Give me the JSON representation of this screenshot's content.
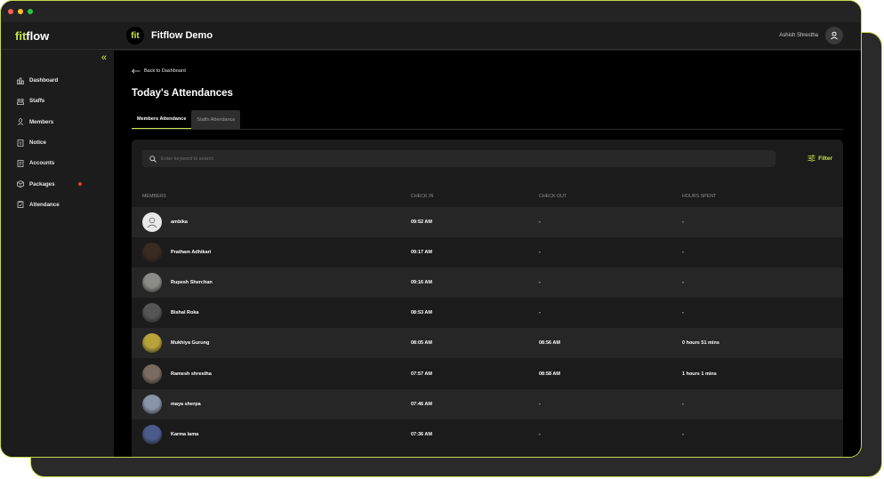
{
  "app": {
    "brand_prefix": "fit",
    "brand_suffix": "flow",
    "org_logo": "fit",
    "org_name": "Fitflow Demo",
    "user_name": "Ashish Shrestha"
  },
  "sidebar": {
    "items": [
      {
        "label": "Dashboard",
        "icon": "chart-icon"
      },
      {
        "label": "Staffs",
        "icon": "staff-icon"
      },
      {
        "label": "Members",
        "icon": "user-icon"
      },
      {
        "label": "Notice",
        "icon": "notice-icon"
      },
      {
        "label": "Accounts",
        "icon": "accounts-icon"
      },
      {
        "label": "Packages",
        "icon": "package-icon"
      },
      {
        "label": "Attendance",
        "icon": "attendance-icon"
      }
    ],
    "badge_color": "#e53935"
  },
  "main": {
    "back_label": "Back to Dashboard",
    "title": "Today's Attendances",
    "tabs": [
      {
        "label": "Members Attendance"
      },
      {
        "label": "Staffs Attendance"
      }
    ],
    "search_placeholder": "Enter keyword to search",
    "filter_label": "Filter",
    "columns": [
      "MEMBERS",
      "CHECK IN",
      "CHECK OUT",
      "HOURS SPENT"
    ],
    "rows": [
      {
        "name": "ambika",
        "check_in": "09:52 AM",
        "check_out": "-",
        "hours": "-",
        "avatar": "#e8e8e8"
      },
      {
        "name": "Pratham Adhikari",
        "check_in": "09:17 AM",
        "check_out": "-",
        "hours": "-",
        "avatar": "#3b2a22"
      },
      {
        "name": "Rupesh Sherchan",
        "check_in": "09:16 AM",
        "check_out": "-",
        "hours": "-",
        "avatar": "#8c8c86"
      },
      {
        "name": "Bishal Roka",
        "check_in": "08:53 AM",
        "check_out": "-",
        "hours": "-",
        "avatar": "#555555"
      },
      {
        "name": "Mukhiya Gurung",
        "check_in": "08:05 AM",
        "check_out": "08:56 AM",
        "hours": "0 hours 51 mins",
        "avatar": "#b8a23a"
      },
      {
        "name": "Ramesh shrestha",
        "check_in": "07:57 AM",
        "check_out": "08:58 AM",
        "hours": "1 hours 1 mins",
        "avatar": "#7a6a60"
      },
      {
        "name": "maya sherpa",
        "check_in": "07:46 AM",
        "check_out": "-",
        "hours": "-",
        "avatar": "#8a94a8"
      },
      {
        "name": "Karma lama",
        "check_in": "07:36 AM",
        "check_out": "-",
        "hours": "-",
        "avatar": "#4a5a8a"
      }
    ]
  },
  "colors": {
    "accent": "#c9e84a",
    "background": "#000000",
    "panel": "#1b1b1b"
  }
}
